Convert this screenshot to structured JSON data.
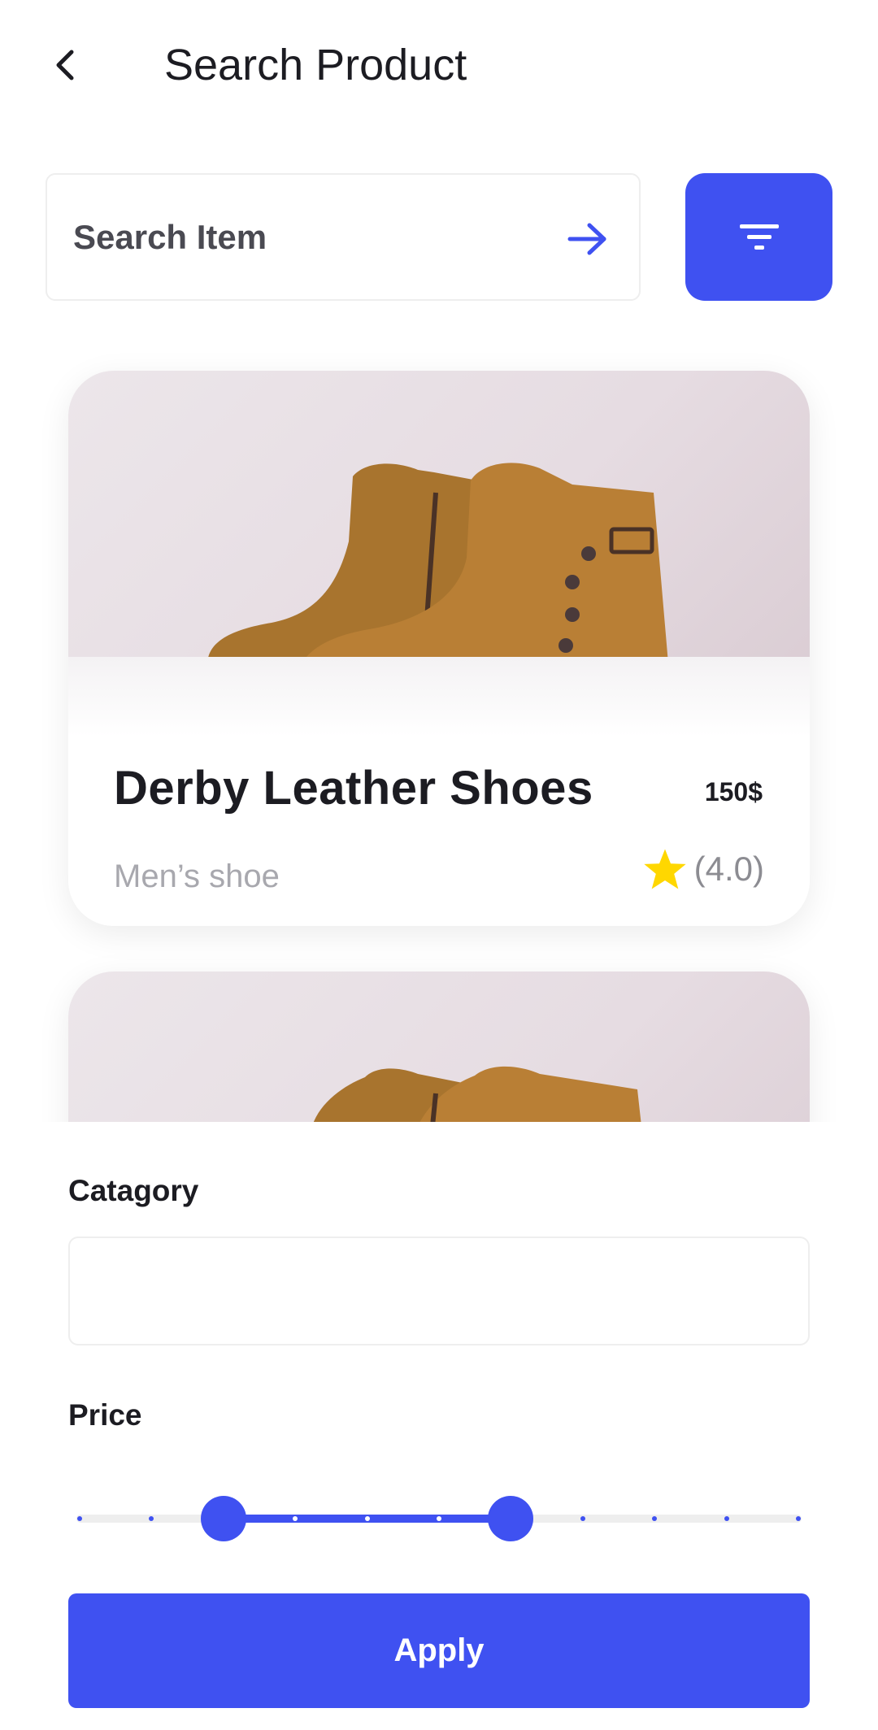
{
  "header": {
    "title": "Search Product"
  },
  "search": {
    "placeholder": "Search Item"
  },
  "products": [
    {
      "name": "Derby Leather Shoes",
      "price": "150$",
      "category": "Men’s shoe",
      "rating": "(4.0)"
    }
  ],
  "filter": {
    "category_label": "Catagory",
    "category_value": "",
    "price_label": "Price",
    "price_range": {
      "low_fraction": 0.2,
      "high_fraction": 0.6,
      "steps": 10
    }
  },
  "apply_label": "Apply",
  "colors": {
    "accent": "#3f51f1",
    "star": "#ffd700",
    "text": "#1c1c22",
    "muted": "#a8a8ae"
  },
  "icons": [
    "back-arrow-icon",
    "arrow-right-icon",
    "filter-icon",
    "star-icon"
  ]
}
